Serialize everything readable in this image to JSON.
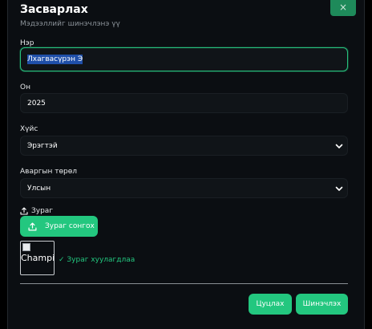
{
  "modal": {
    "title": "Засварлах",
    "subtitle": "Мэдээллийг шинэчлэнэ үү",
    "close_label": "×"
  },
  "fields": {
    "name": {
      "label": "Нэр",
      "value": "Лхагвасүрэн Э"
    },
    "year": {
      "label": "Он",
      "value": "2025"
    },
    "gender": {
      "label": "Хүйс",
      "value": "Эрэгтэй"
    },
    "category": {
      "label": "Аваргын төрөл",
      "value": "Улсын"
    }
  },
  "upload": {
    "label": "Зураг",
    "button_label": "Зураг сонгох",
    "preview_alt": "Champion",
    "status": "✓ Зураг хуулагдлаа"
  },
  "actions": {
    "cancel_label": "Цуцлах",
    "save_label": "Шинэчлэх"
  },
  "colors": {
    "accent": "#23c77f",
    "background": "#0b0e12"
  }
}
